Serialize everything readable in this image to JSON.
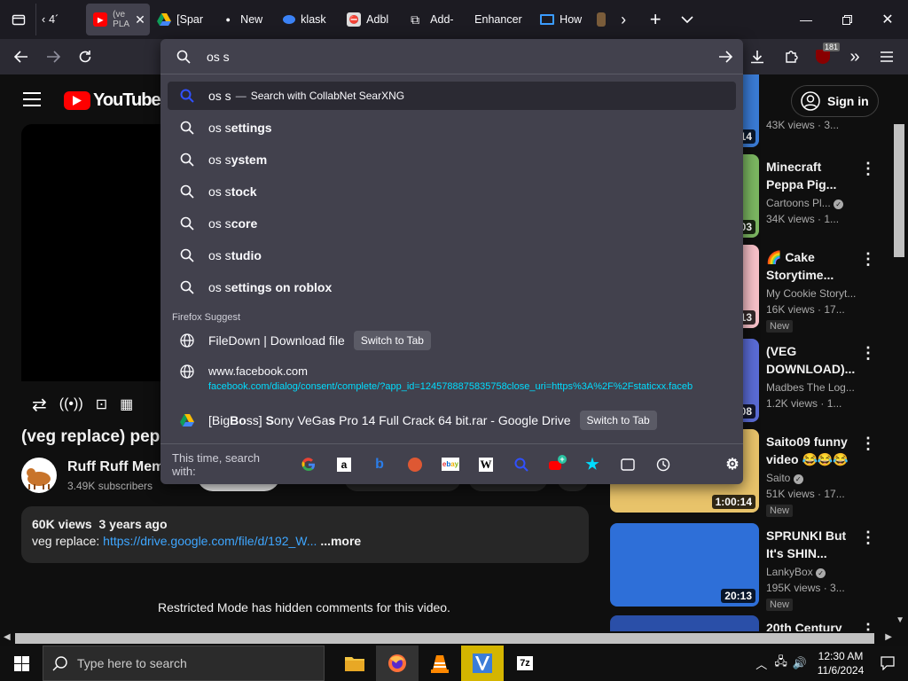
{
  "tabs": [
    {
      "label": "4´",
      "icon": "tab-list-icon"
    },
    {
      "label": "(ve PLA",
      "icon": "youtube-icon",
      "active": true
    },
    {
      "label": "[Spar",
      "icon": "google-drive-icon"
    },
    {
      "label": "New",
      "icon": "dot-icon"
    },
    {
      "label": "klask",
      "icon": "klask-icon"
    },
    {
      "label": "Adbl",
      "icon": "adblock-icon"
    },
    {
      "label": "Add-",
      "icon": "puzzle-icon"
    },
    {
      "label": "Enhancer",
      "icon": "none"
    },
    {
      "label": "How",
      "icon": "monitor-icon"
    }
  ],
  "urlbar": {
    "value": "os s",
    "badge": "181"
  },
  "suggestions": {
    "search_row": {
      "query": "os s",
      "separator": "—",
      "engine_text": "Search with CollabNet SearXNG"
    },
    "items": [
      {
        "prefix": "os s",
        "rest": "ettings"
      },
      {
        "prefix": "os s",
        "rest": "ystem"
      },
      {
        "prefix": "os s",
        "rest": "tock"
      },
      {
        "prefix": "os s",
        "rest": "core"
      },
      {
        "prefix": "os s",
        "rest": "tudio"
      },
      {
        "prefix": "os s",
        "rest": "ettings on roblox"
      }
    ],
    "firefox_suggest_label": "Firefox Suggest",
    "filedown": {
      "title": "FileDown | Download file",
      "button": "Switch to Tab"
    },
    "facebook": {
      "title": "www.facebook.com",
      "url": "facebook.com/dialog/consent/complete/?app_id=1245788875835758close_uri=https%3A%2F%2Fstaticxx.faceb"
    },
    "drive": {
      "pre": "[Big",
      "b1": "Bo",
      "mid1": "ss] ",
      "b2": "S",
      "mid2": "ony VeGa",
      "b3": "s",
      "post": " Pro 14 Full Crack 64 bit.rar - Google Drive",
      "button": "Switch to Tab"
    },
    "one_off_label": "This time, search with:",
    "engines": [
      "google-icon",
      "amazon-icon",
      "bing-icon",
      "duckduckgo-icon",
      "ebay-icon",
      "wikipedia-icon",
      "searxng-icon",
      "youtube-add-icon",
      "bookmarks-icon",
      "tabs-icon",
      "history-icon",
      "settings-icon"
    ]
  },
  "youtube": {
    "logo": "YouTube",
    "sign_in": "Sign in",
    "video_title": "(veg replace) pep",
    "channel": "Ruff Ruff Mem",
    "subscribers": "3.49K subscribers",
    "views_line": "60K views  3 years ago",
    "desc_label": "veg replace: ",
    "desc_link": "https://drive.google.com/file/d/192_W...",
    "more": "...more",
    "restricted": "Restricted Mode has hidden comments for this video."
  },
  "sidebar": [
    {
      "title1": "",
      "title2": "",
      "channel": "",
      "meta": "43K views · 3...",
      "dur": "14",
      "new": false
    },
    {
      "title1": "Minecraft",
      "title2": "Peppa Pig...",
      "channel": "Cartoons Pl...",
      "verified": true,
      "meta": "34K views · 1...",
      "dur": "03",
      "new": false
    },
    {
      "title1": "🌈 Cake",
      "title2": "Storytime...",
      "channel": "My Cookie Storyt...",
      "meta": "16K views · 17...",
      "dur": "13",
      "new": true
    },
    {
      "title1": "(VEG",
      "title2": "DOWNLOAD)...",
      "channel": "Madbes The Log...",
      "meta": "1.2K views · 1...",
      "dur": "08",
      "new": false
    },
    {
      "title1": "Saito09 funny",
      "title2": "video 😂😂😂",
      "channel": "Saito",
      "verified": true,
      "meta": "51K views · 17...",
      "dur": "1:00:14",
      "new": true
    },
    {
      "title1": "SPRUNKI But",
      "title2": "It's SHIN...",
      "channel": "LankyBox",
      "verified": true,
      "meta": "195K views · 3...",
      "dur": "20:13",
      "new": true
    },
    {
      "title1": "20th Century",
      "title2": "",
      "channel": "",
      "meta": "",
      "dur": "",
      "new": false
    }
  ],
  "new_label": "New",
  "taskbar": {
    "search_placeholder": "Type here to search",
    "time": "12:30 AM",
    "date": "11/6/2024"
  }
}
